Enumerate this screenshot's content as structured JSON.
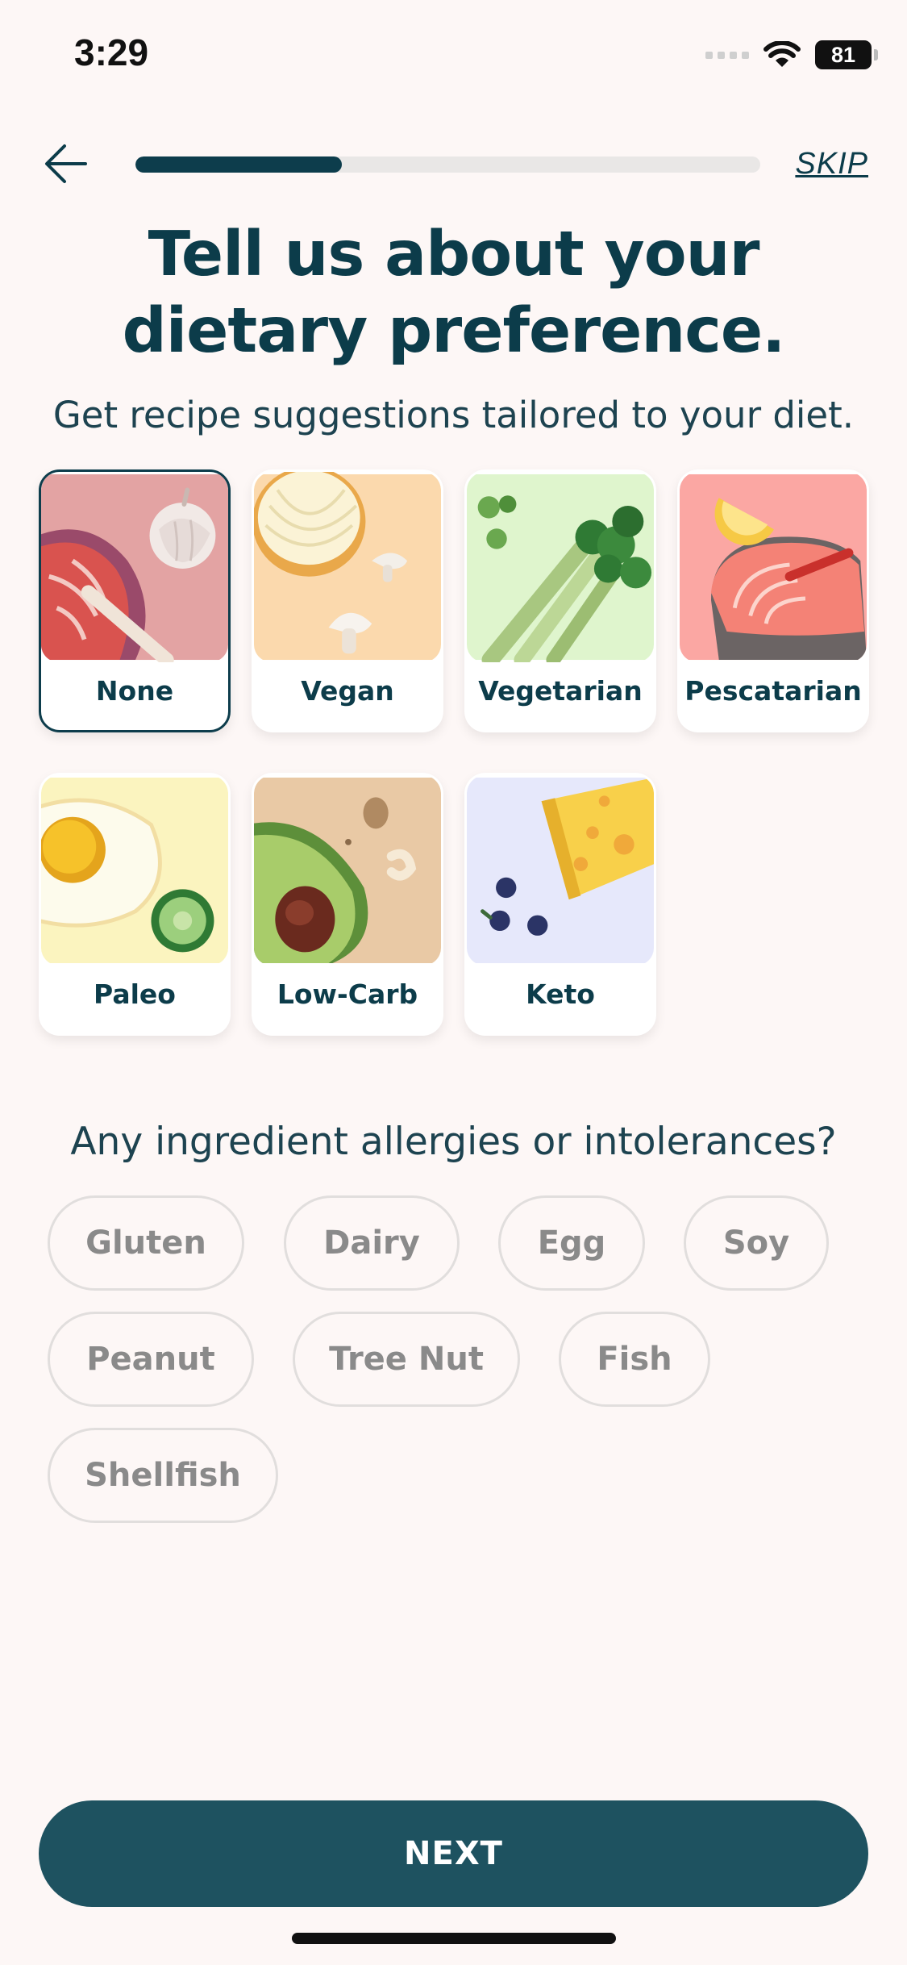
{
  "status_bar": {
    "time": "3:29",
    "battery": "81"
  },
  "header": {
    "skip_label": "SKIP",
    "progress": 0.33
  },
  "title": "Tell us about your dietary preference.",
  "subtitle": "Get recipe suggestions tailored to your diet.",
  "diets": [
    {
      "label": "None",
      "selected": true
    },
    {
      "label": "Vegan",
      "selected": false
    },
    {
      "label": "Vegetarian",
      "selected": false
    },
    {
      "label": "Pescatarian",
      "selected": false
    },
    {
      "label": "Paleo",
      "selected": false
    },
    {
      "label": "Low-Carb",
      "selected": false
    },
    {
      "label": "Keto",
      "selected": false
    }
  ],
  "allergies": {
    "title": "Any ingredient allergies or intolerances?",
    "options": [
      "Gluten",
      "Dairy",
      "Egg",
      "Soy",
      "Peanut",
      "Tree Nut",
      "Fish",
      "Shellfish"
    ]
  },
  "next_label": "NEXT",
  "colors": {
    "accent": "#0d3d4c",
    "button": "#1e5260",
    "background": "#fdf7f6"
  }
}
